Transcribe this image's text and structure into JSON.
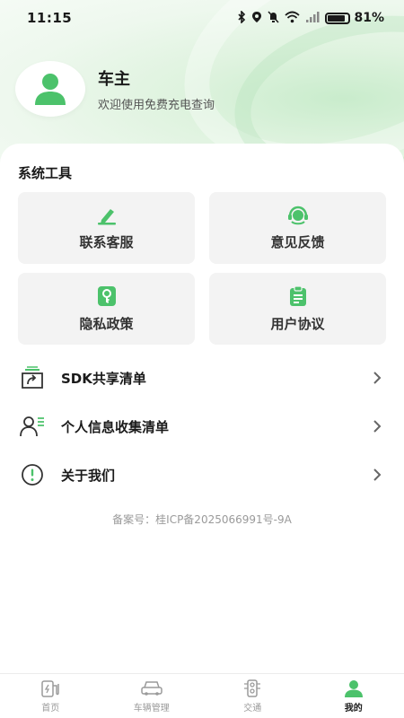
{
  "status_bar": {
    "time": "11:15",
    "battery_text": "81%"
  },
  "profile": {
    "name": "车主",
    "subtitle": "欢迎使用免费充电查询"
  },
  "section": {
    "title": "系统工具"
  },
  "tools": [
    {
      "label": "联系客服",
      "icon": "pen-icon"
    },
    {
      "label": "意见反馈",
      "icon": "headset-icon"
    },
    {
      "label": "隐私政策",
      "icon": "key-icon"
    },
    {
      "label": "用户协议",
      "icon": "clipboard-icon"
    }
  ],
  "menu": [
    {
      "label": "SDK共享清单",
      "icon": "share-box-icon"
    },
    {
      "label": "个人信息收集清单",
      "icon": "person-list-icon"
    },
    {
      "label": "关于我们",
      "icon": "info-icon"
    }
  ],
  "footer": {
    "icp": "备案号：桂ICP备2025066991号-9A"
  },
  "tabbar": [
    {
      "label": "首页",
      "icon": "charger-icon",
      "active": false
    },
    {
      "label": "车辆管理",
      "icon": "car-icon",
      "active": false
    },
    {
      "label": "交通",
      "icon": "traffic-light-icon",
      "active": false
    },
    {
      "label": "我的",
      "icon": "person-icon",
      "active": true
    }
  ],
  "colors": {
    "accent": "#4cc26b",
    "header_bg": "#dff3df",
    "card_bg": "#f3f3f3",
    "inactive_tab": "#9a9a9a"
  }
}
